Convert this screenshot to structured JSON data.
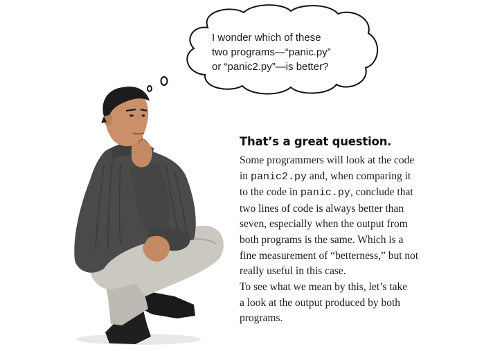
{
  "thought_bubble": {
    "lines": [
      "I wonder which of these",
      "two programs—“panic.py”",
      "or “panic2.py”—is better?"
    ]
  },
  "heading": "That’s a great question.",
  "paragraph1": {
    "l1": "Some programmers will look at the code",
    "l2a": "in ",
    "l2code": "panic2.py",
    "l2b": " and, when comparing it",
    "l3a": "to the code in ",
    "l3code": "panic.py",
    "l3b": ", conclude that",
    "l4": "two lines of code is always better than",
    "l5": "seven, especially when the output from",
    "l6": "both programs is the same. Which is a",
    "l7": "fine measurement of “betterness,” but not",
    "l8": "really useful in this case."
  },
  "paragraph2": {
    "lines": [
      "To see what we mean by this, let’s take",
      "a look at the output produced by both",
      "programs."
    ]
  },
  "colors": {
    "sweater": "#4a4a4a",
    "pants": "#c9c6c0",
    "skin": "#c9906a",
    "hair": "#1c1c1c",
    "shoes": "#1a1a1a"
  }
}
